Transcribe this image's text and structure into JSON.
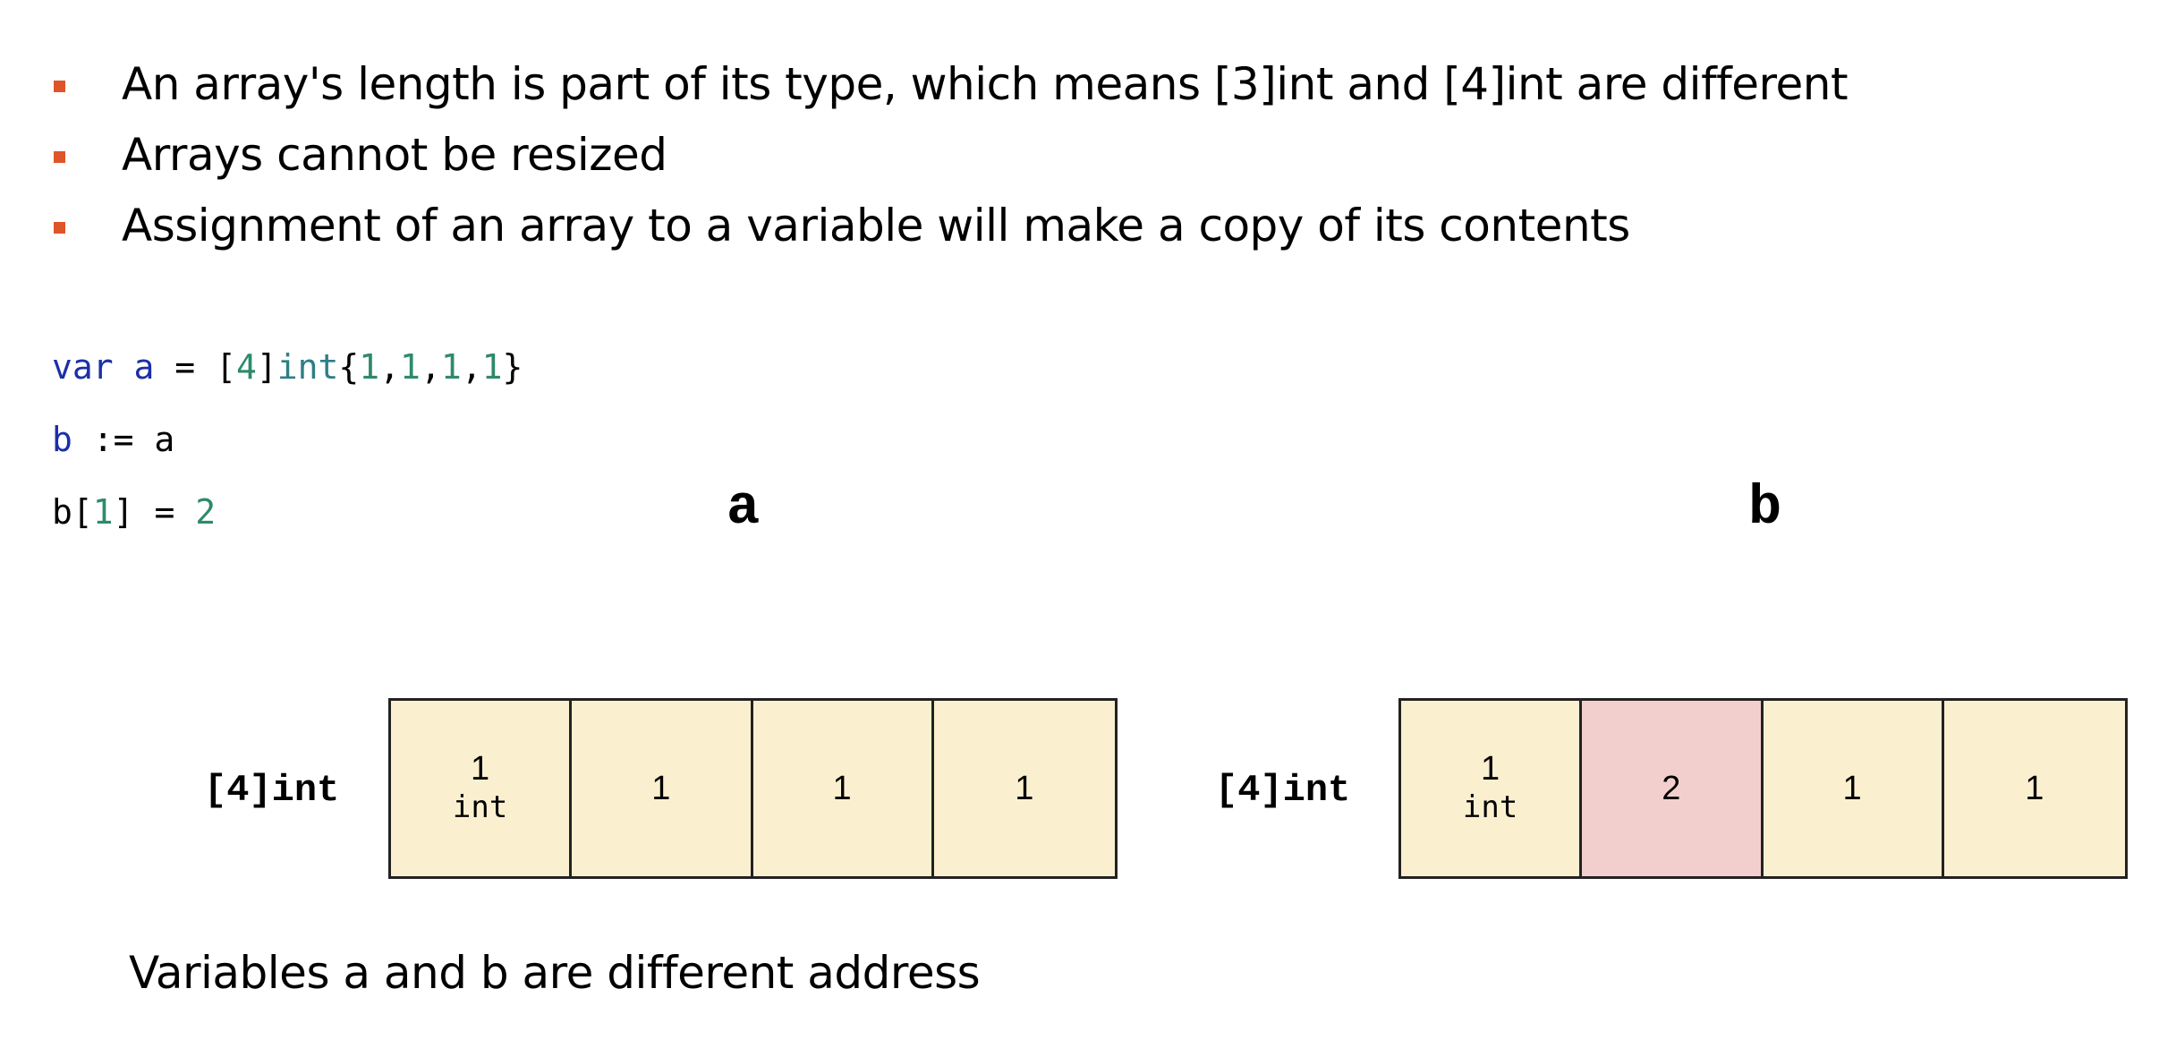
{
  "bullets": [
    "An array's length is part of its type, which means [3]int and [4]int are different",
    "Arrays cannot be resized",
    "Assignment of an array to a variable will make a copy of its contents"
  ],
  "code": {
    "line1": {
      "kw": "var",
      "name": "a",
      "eq": " = ",
      "open": "[",
      "len": "4",
      "close": "]",
      "type": "int",
      "lbrace": "{",
      "v1": "1",
      "c1": ",",
      "v2": "1",
      "c2": ",",
      "v3": "1",
      "c3": ",",
      "v4": "1",
      "rbrace": "}"
    },
    "line2": {
      "name": "b",
      "op": " := ",
      "src": "a"
    },
    "line3": {
      "name": "b",
      "open": "[",
      "idx": "1",
      "close": "]",
      "eq": " = ",
      "val": "2"
    }
  },
  "diagram": {
    "a": {
      "label": "a",
      "type_label": "[4]int",
      "cells": [
        {
          "value": "1",
          "type": "int"
        },
        {
          "value": "1"
        },
        {
          "value": "1"
        },
        {
          "value": "1"
        }
      ]
    },
    "b": {
      "label": "b",
      "type_label": "[4]int",
      "cells": [
        {
          "value": "1",
          "type": "int"
        },
        {
          "value": "2",
          "highlight_color": "#f2cfcd"
        },
        {
          "value": "1"
        },
        {
          "value": "1"
        }
      ]
    }
  },
  "caption": "Variables a and b are different address",
  "colors": {
    "bullet_marker": "#e0542a",
    "cell_fill": "#faf0cf",
    "changed_cell_fill": "#f2cfcd",
    "keyword": "#1b2fa8",
    "number": "#2e8a6a"
  }
}
